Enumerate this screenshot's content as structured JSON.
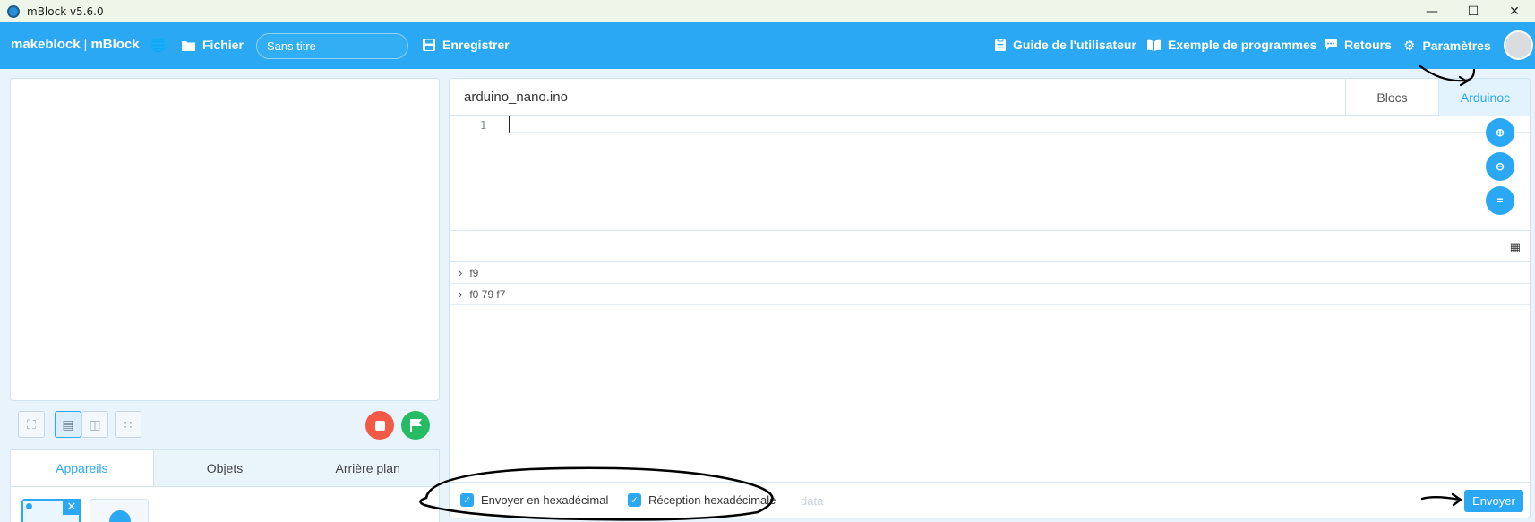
{
  "window": {
    "title": "mBlock v5.6.0",
    "controls": [
      "—",
      "☐",
      "✕"
    ]
  },
  "header": {
    "logo_brand": "makeblock",
    "logo_sep": "|",
    "logo_product": "mBlock",
    "file_label": "Fichier",
    "title_value": "Sans titre",
    "save_label": "Enregistrer",
    "guide_label": "Guide de l'utilisateur",
    "examples_label": "Exemple de programmes",
    "feedback_label": "Retours",
    "settings_label": "Paramètres"
  },
  "left": {
    "tabs": [
      {
        "label": "Appareils",
        "active": true
      },
      {
        "label": "Objets",
        "active": false
      },
      {
        "label": "Arrière plan",
        "active": false
      }
    ]
  },
  "editor": {
    "filename": "arduino_nano.ino",
    "view_tabs": [
      {
        "label": "Blocs",
        "active": false
      },
      {
        "label": "Arduinoc",
        "active": true
      }
    ],
    "line_number": "1"
  },
  "serial": {
    "log": [
      "f9",
      "f0 79 f7"
    ],
    "send_hex_label": "Envoyer en hexadécimal",
    "receive_hex_label": "Réception hexadécimale",
    "input_placeholder": "data",
    "send_button": "Envoyer"
  },
  "colors": {
    "accent": "#2ba8f3",
    "stop": "#f05a47",
    "go": "#27bc63"
  }
}
